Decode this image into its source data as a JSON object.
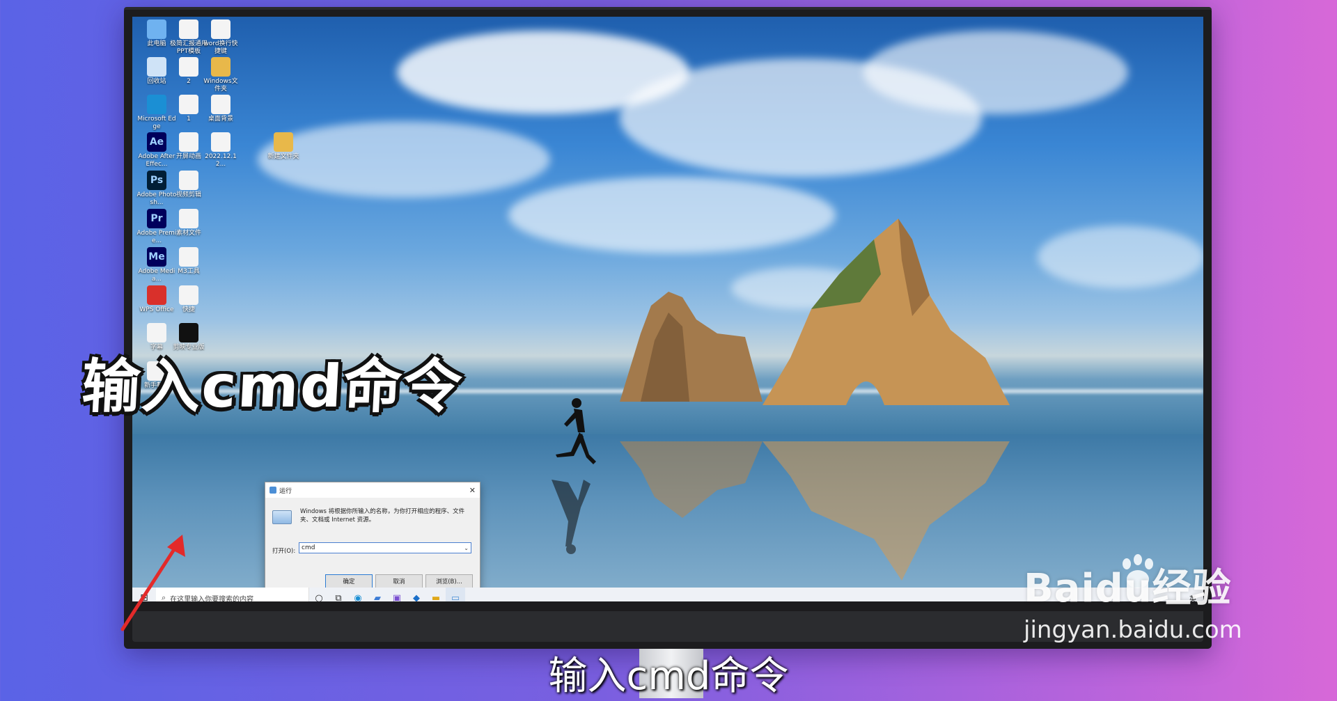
{
  "overlay": {
    "headline": "输入cmd命令",
    "subtitle": "输入cmd命令",
    "watermark_brand": "Baidu经验",
    "watermark_url": "jingyan.baidu.com"
  },
  "desktop_icons": [
    {
      "label": "此电脑",
      "icon": "pc-icon"
    },
    {
      "label": "极简汇报通用PPT模板",
      "icon": "ppt-file-icon"
    },
    {
      "label": "word换行快捷键",
      "icon": "file-icon"
    },
    {
      "label": "回收站",
      "icon": "recycle-bin-icon"
    },
    {
      "label": "2",
      "icon": "image-file-icon"
    },
    {
      "label": "Windows文件夹",
      "icon": "folder-icon"
    },
    {
      "label": "Microsoft Edge",
      "icon": "edge-icon"
    },
    {
      "label": "1",
      "icon": "image-file-icon"
    },
    {
      "label": "桌面背景",
      "icon": "image-file-icon"
    },
    {
      "label": "Adobe After Effec...",
      "icon": "after-effects-icon",
      "glyph": "Ae"
    },
    {
      "label": "开屏动画",
      "icon": "video-file-icon"
    },
    {
      "label": "2022.12.12...",
      "icon": "doc-file-icon"
    },
    {
      "label": "新建文件夹",
      "icon": "folder-icon"
    },
    {
      "label": "Adobe Photosh...",
      "icon": "photoshop-icon",
      "glyph": "Ps"
    },
    {
      "label": "视频剪辑",
      "icon": "file-icon"
    },
    {
      "label": "Adobe Premie...",
      "icon": "premiere-icon",
      "glyph": "Pr"
    },
    {
      "label": "素材文件",
      "icon": "file-icon"
    },
    {
      "label": "Adobe Media...",
      "icon": "media-encoder-icon",
      "glyph": "Me"
    },
    {
      "label": "M3工具",
      "icon": "file-icon"
    },
    {
      "label": "WPS Office",
      "icon": "wps-icon"
    },
    {
      "label": "快捷",
      "icon": "file-icon"
    },
    {
      "label": "字幕",
      "icon": "file-icon"
    },
    {
      "label": "剪映专业版",
      "icon": "capcut-icon"
    },
    {
      "label": "新手教程",
      "icon": "file-icon"
    }
  ],
  "run_dialog": {
    "title": "运行",
    "description": "Windows 将根据你所输入的名称，为你打开相应的程序、文件夹、文档或 Internet 资源。",
    "open_label": "打开(O):",
    "open_value": "cmd",
    "ok_label": "确定",
    "cancel_label": "取消",
    "browse_label": "浏览(B)..."
  },
  "taskbar": {
    "search_placeholder": "在这里输入你要搜索的内容",
    "ime": "英"
  }
}
